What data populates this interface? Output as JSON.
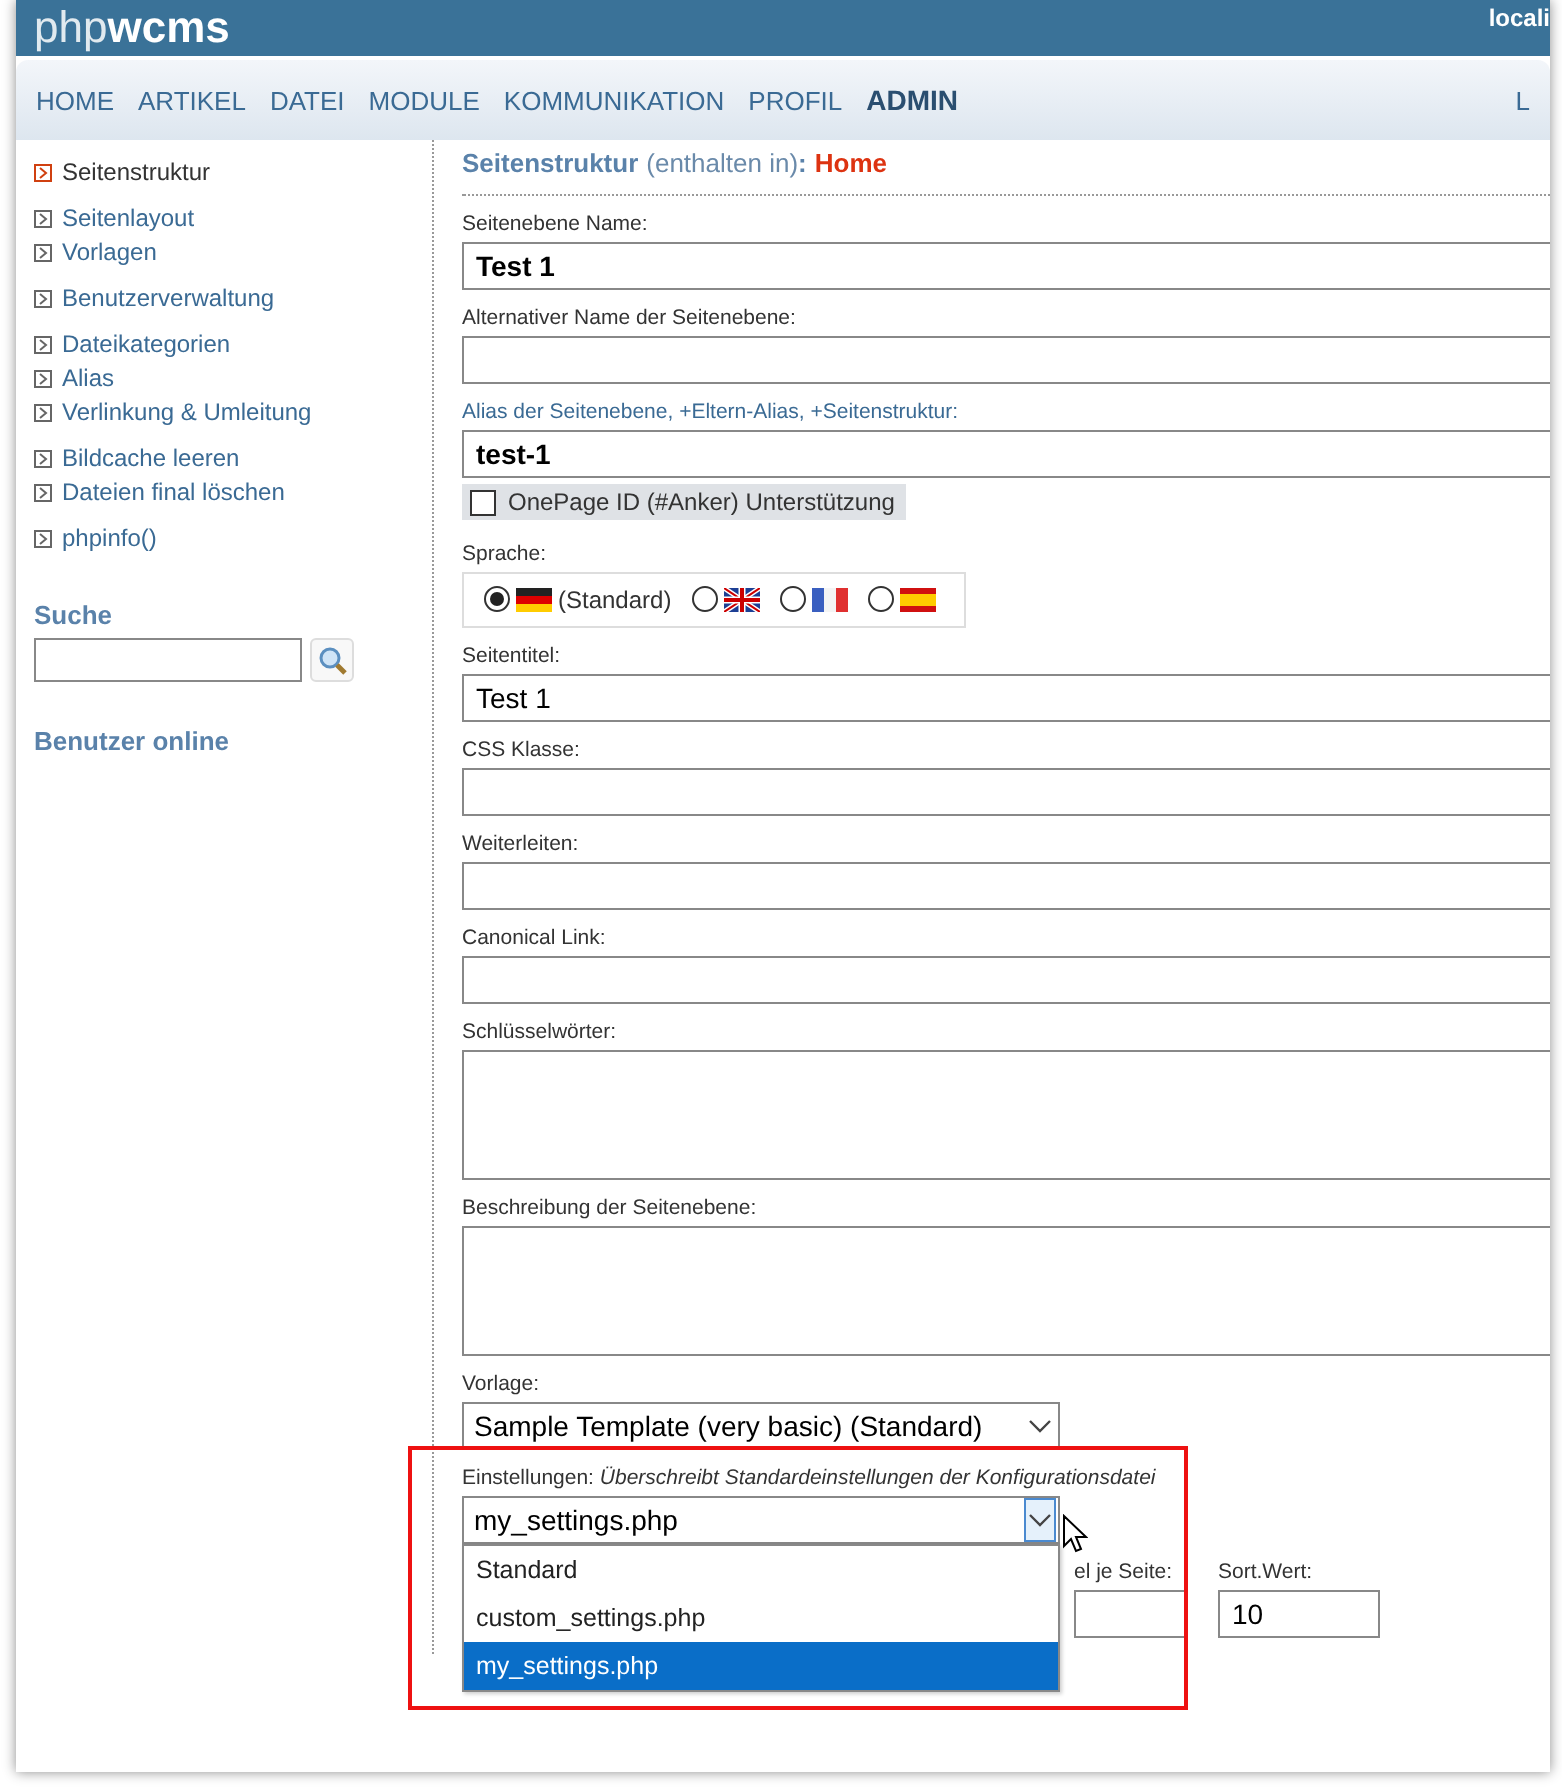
{
  "header": {
    "logo_light": "php",
    "logo_bold": "wcms",
    "user": "locali"
  },
  "nav": {
    "items": [
      {
        "label": "HOME",
        "selected": false
      },
      {
        "label": "ARTIKEL",
        "selected": false
      },
      {
        "label": "DATEI",
        "selected": false
      },
      {
        "label": "MODULE",
        "selected": false
      },
      {
        "label": "KOMMUNIKATION",
        "selected": false
      },
      {
        "label": "PROFIL",
        "selected": false
      },
      {
        "label": "ADMIN",
        "selected": true
      }
    ],
    "right": "L"
  },
  "sidebar": {
    "groups": [
      [
        {
          "label": "Seitenstruktur",
          "selected": true
        }
      ],
      [
        {
          "label": "Seitenlayout",
          "selected": false
        },
        {
          "label": "Vorlagen",
          "selected": false
        }
      ],
      [
        {
          "label": "Benutzerverwaltung",
          "selected": false
        }
      ],
      [
        {
          "label": "Dateikategorien",
          "selected": false
        },
        {
          "label": "Alias",
          "selected": false
        },
        {
          "label": "Verlinkung & Umleitung",
          "selected": false
        }
      ],
      [
        {
          "label": "Bildcache leeren",
          "selected": false
        },
        {
          "label": "Dateien final löschen",
          "selected": false
        }
      ],
      [
        {
          "label": "phpinfo()",
          "selected": false
        }
      ]
    ],
    "search_title": "Suche",
    "online_title": "Benutzer online"
  },
  "form": {
    "title": "Seitenstruktur",
    "context": "(enthalten in)",
    "separator": ":",
    "parent": "Home",
    "fields": [
      {
        "kind": "text",
        "label": "Seitenebene Name:",
        "value": "Test 1",
        "bold": true
      },
      {
        "kind": "text",
        "label": "Alternativer Name der Seitenebene:"
      },
      {
        "kind": "text",
        "label": "Alias der Seitenebene, +Eltern-Alias, +Seitenstruktur:",
        "value": "test-1",
        "bold": true,
        "label_highlight": true
      },
      {
        "kind": "checkbox",
        "label": "OnePage ID (#Anker) Unterstützung",
        "checked": false
      },
      {
        "kind": "radios",
        "label": "Sprache:",
        "options": [
          {
            "kind": "de",
            "label": "(Standard)",
            "selected": true
          },
          {
            "kind": "gb",
            "selected": false
          },
          {
            "kind": "fr",
            "selected": false
          },
          {
            "kind": "es",
            "selected": false
          }
        ]
      },
      {
        "kind": "text",
        "label": "Seitentitel:",
        "value": "Test 1",
        "bold": false
      },
      {
        "kind": "text",
        "label": "CSS Klasse:"
      },
      {
        "kind": "text",
        "label": "Weiterleiten:"
      },
      {
        "kind": "text",
        "label": "Canonical Link:"
      },
      {
        "kind": "textarea",
        "label": "Schlüsselwörter:"
      },
      {
        "kind": "textarea",
        "label": "Beschreibung der Seitenebene:"
      },
      {
        "kind": "select",
        "label": "Vorlage:",
        "value": "Sample Template (very basic) (Standard)",
        "open": false
      },
      {
        "kind": "select",
        "label": "Einstellungen:",
        "note": "Überschreibt Standardeinstellungen der Konfigurationsdatei",
        "value": "my_settings.php",
        "open": true,
        "options": [
          {
            "label": "Standard",
            "selected": false
          },
          {
            "label": "custom_settings.php",
            "selected": false
          },
          {
            "label": "my_settings.php",
            "selected": true
          }
        ]
      }
    ],
    "extra_row": [
      {
        "label": "el je Seite:"
      },
      {
        "label": "Sort.Wert:",
        "value": "10"
      }
    ]
  }
}
